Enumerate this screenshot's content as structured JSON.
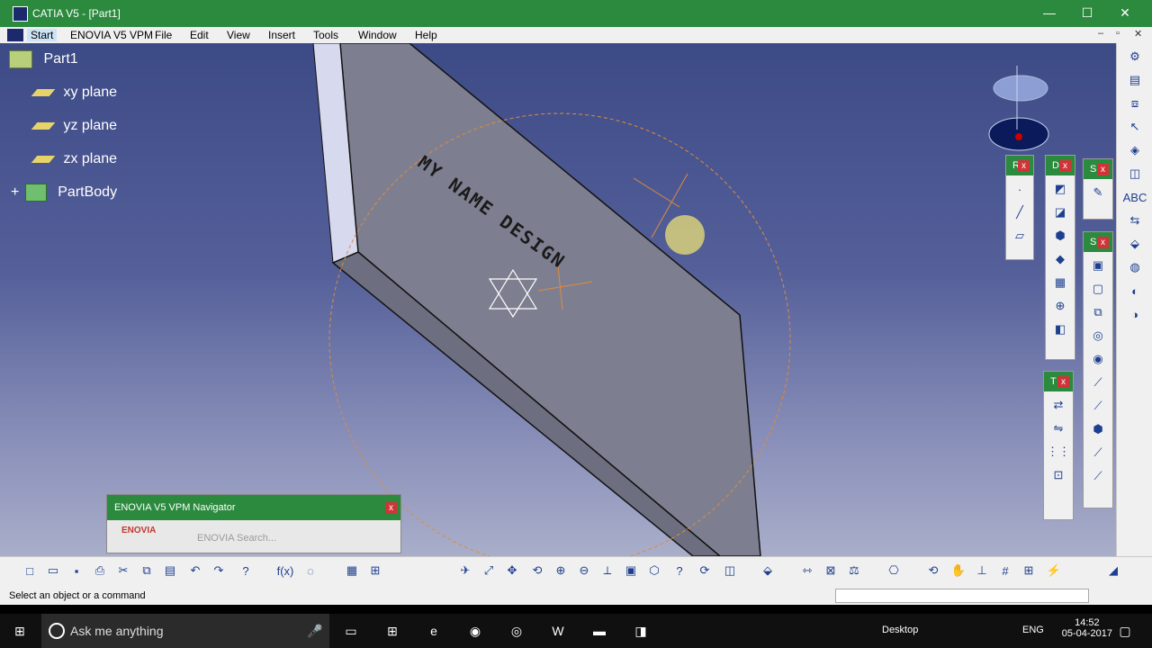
{
  "window": {
    "title": "CATIA V5 - [Part1]",
    "controls": [
      "—",
      "☐",
      "✕"
    ]
  },
  "menu": {
    "start": "Start",
    "enovia": "ENOVIA V5 VPM",
    "file": "File",
    "edit": "Edit",
    "view": "View",
    "insert": "Insert",
    "tools": "Tools",
    "window": "Window",
    "help": "Help",
    "mdi_controls": [
      "–",
      "▫",
      "✕"
    ]
  },
  "tree": {
    "root": "Part1",
    "planes": [
      "xy plane",
      "yz plane",
      "zx plane"
    ],
    "body": "PartBody"
  },
  "model": {
    "engraved_text": "MY NAME DESIGN"
  },
  "toolbars": {
    "reference": {
      "label": "R"
    },
    "dress_up": {
      "label": "D"
    },
    "sketcher": {
      "label": "S"
    },
    "surface": {
      "label": "S"
    },
    "transform": {
      "label": "T"
    }
  },
  "navigator": {
    "title": "ENOVIA V5 VPM Navigator",
    "logo": "ENOVIA",
    "search_placeholder": "ENOVIA Search..."
  },
  "status": {
    "message": "Select an object or a command"
  },
  "taskbar": {
    "search": "Ask me anything",
    "desktop": "Desktop",
    "language": "ENG",
    "time": "14:52",
    "date": "05-04-2017"
  },
  "colors": {
    "accent_green": "#2b8a3e",
    "viewport_top": "#3c4a86",
    "viewport_bottom": "#a9aeca",
    "plate_fill": "#7d7f90",
    "sketch_orange": "#e08a3c"
  }
}
